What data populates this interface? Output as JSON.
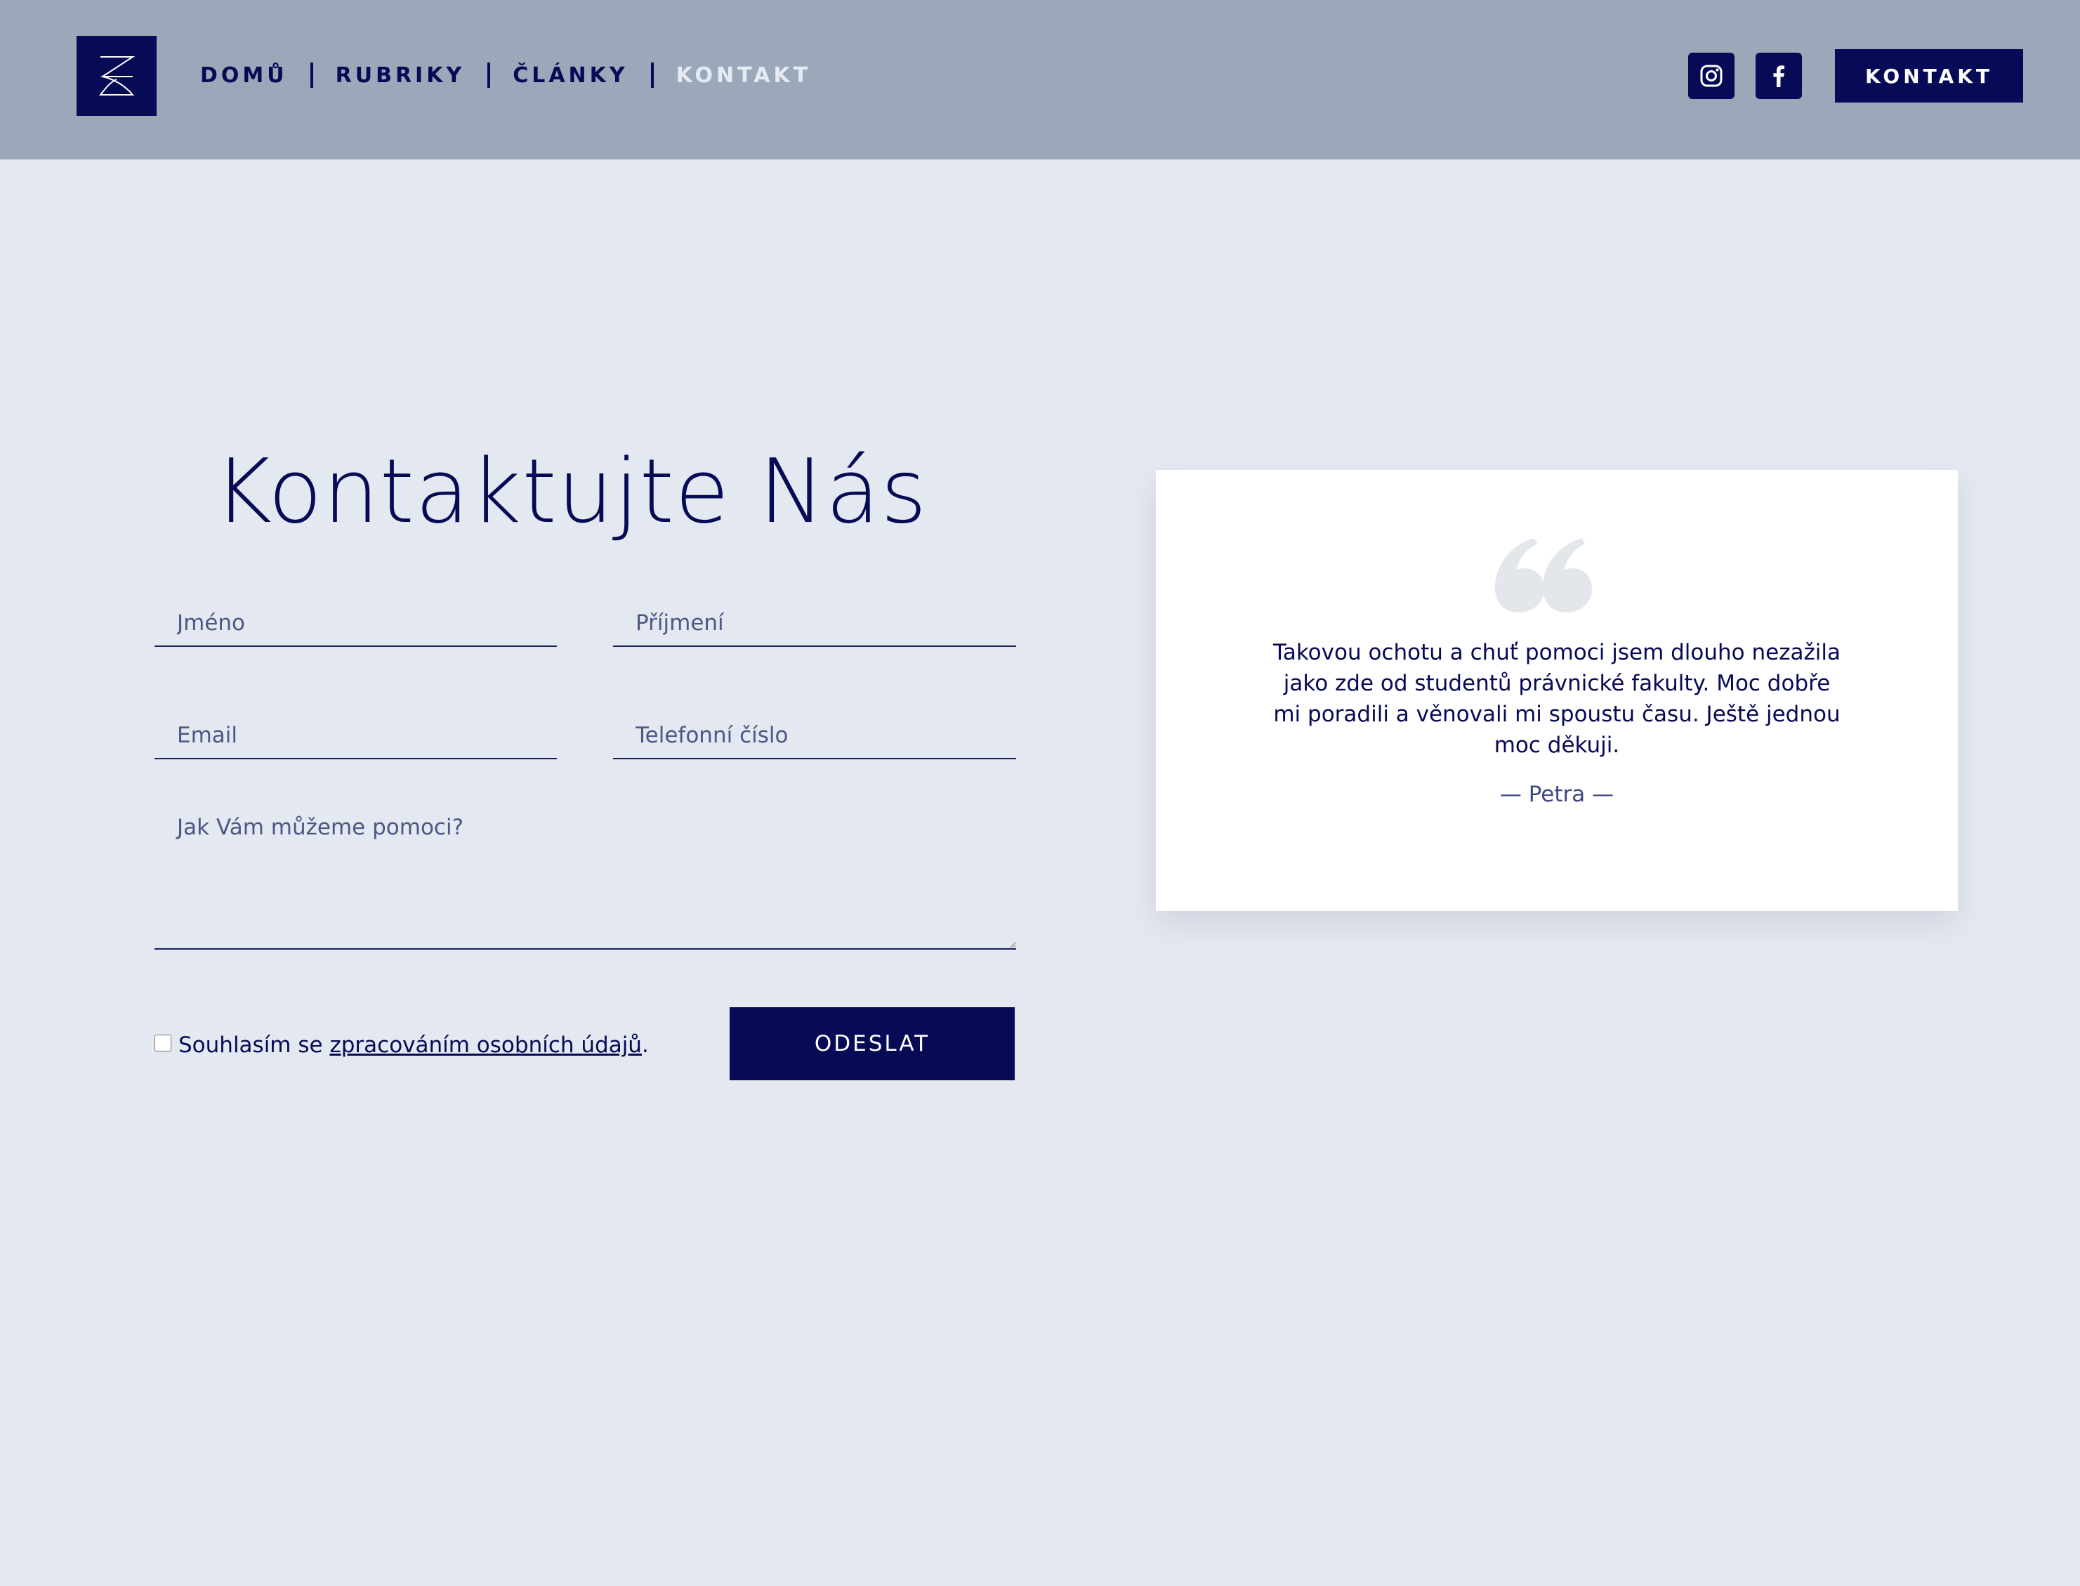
{
  "header": {
    "logo_icon": "hourglass-z-logo",
    "nav": [
      {
        "label": "DOMŮ",
        "active": false
      },
      {
        "label": "RUBRIKY",
        "active": false
      },
      {
        "label": "ČLÁNKY",
        "active": false
      },
      {
        "label": "KONTAKT",
        "active": true
      }
    ],
    "social": [
      {
        "icon": "instagram-icon"
      },
      {
        "icon": "facebook-icon"
      }
    ],
    "cta_label": "KONTAKT"
  },
  "form": {
    "title": "Kontaktujte Nás",
    "first_name_placeholder": "Jméno",
    "last_name_placeholder": "Příjmení",
    "email_placeholder": "Email",
    "phone_placeholder": "Telefonní číslo",
    "message_placeholder": "Jak Vám můžeme pomoci?",
    "consent_prefix": "Souhlasím se ",
    "consent_link": "zpracováním osobních údajů",
    "consent_suffix": ".",
    "consent_checked": false,
    "submit_label": "ODESLAT"
  },
  "testimonial": {
    "quote_icon": "quote-icon",
    "text": "Takovou ochotu a chuť pomoci jsem dlouho nezažila jako zde od studentů právnické fakulty. Moc dobře mi poradili a věnovali mi spoustu času. Ještě jednou moc děkuji.",
    "author": "— Petra —"
  },
  "colors": {
    "header_bg": "#9ba8ba",
    "page_bg": "#e4e8f0",
    "brand": "#070a55",
    "quote_mark": "#e3e6ea"
  }
}
